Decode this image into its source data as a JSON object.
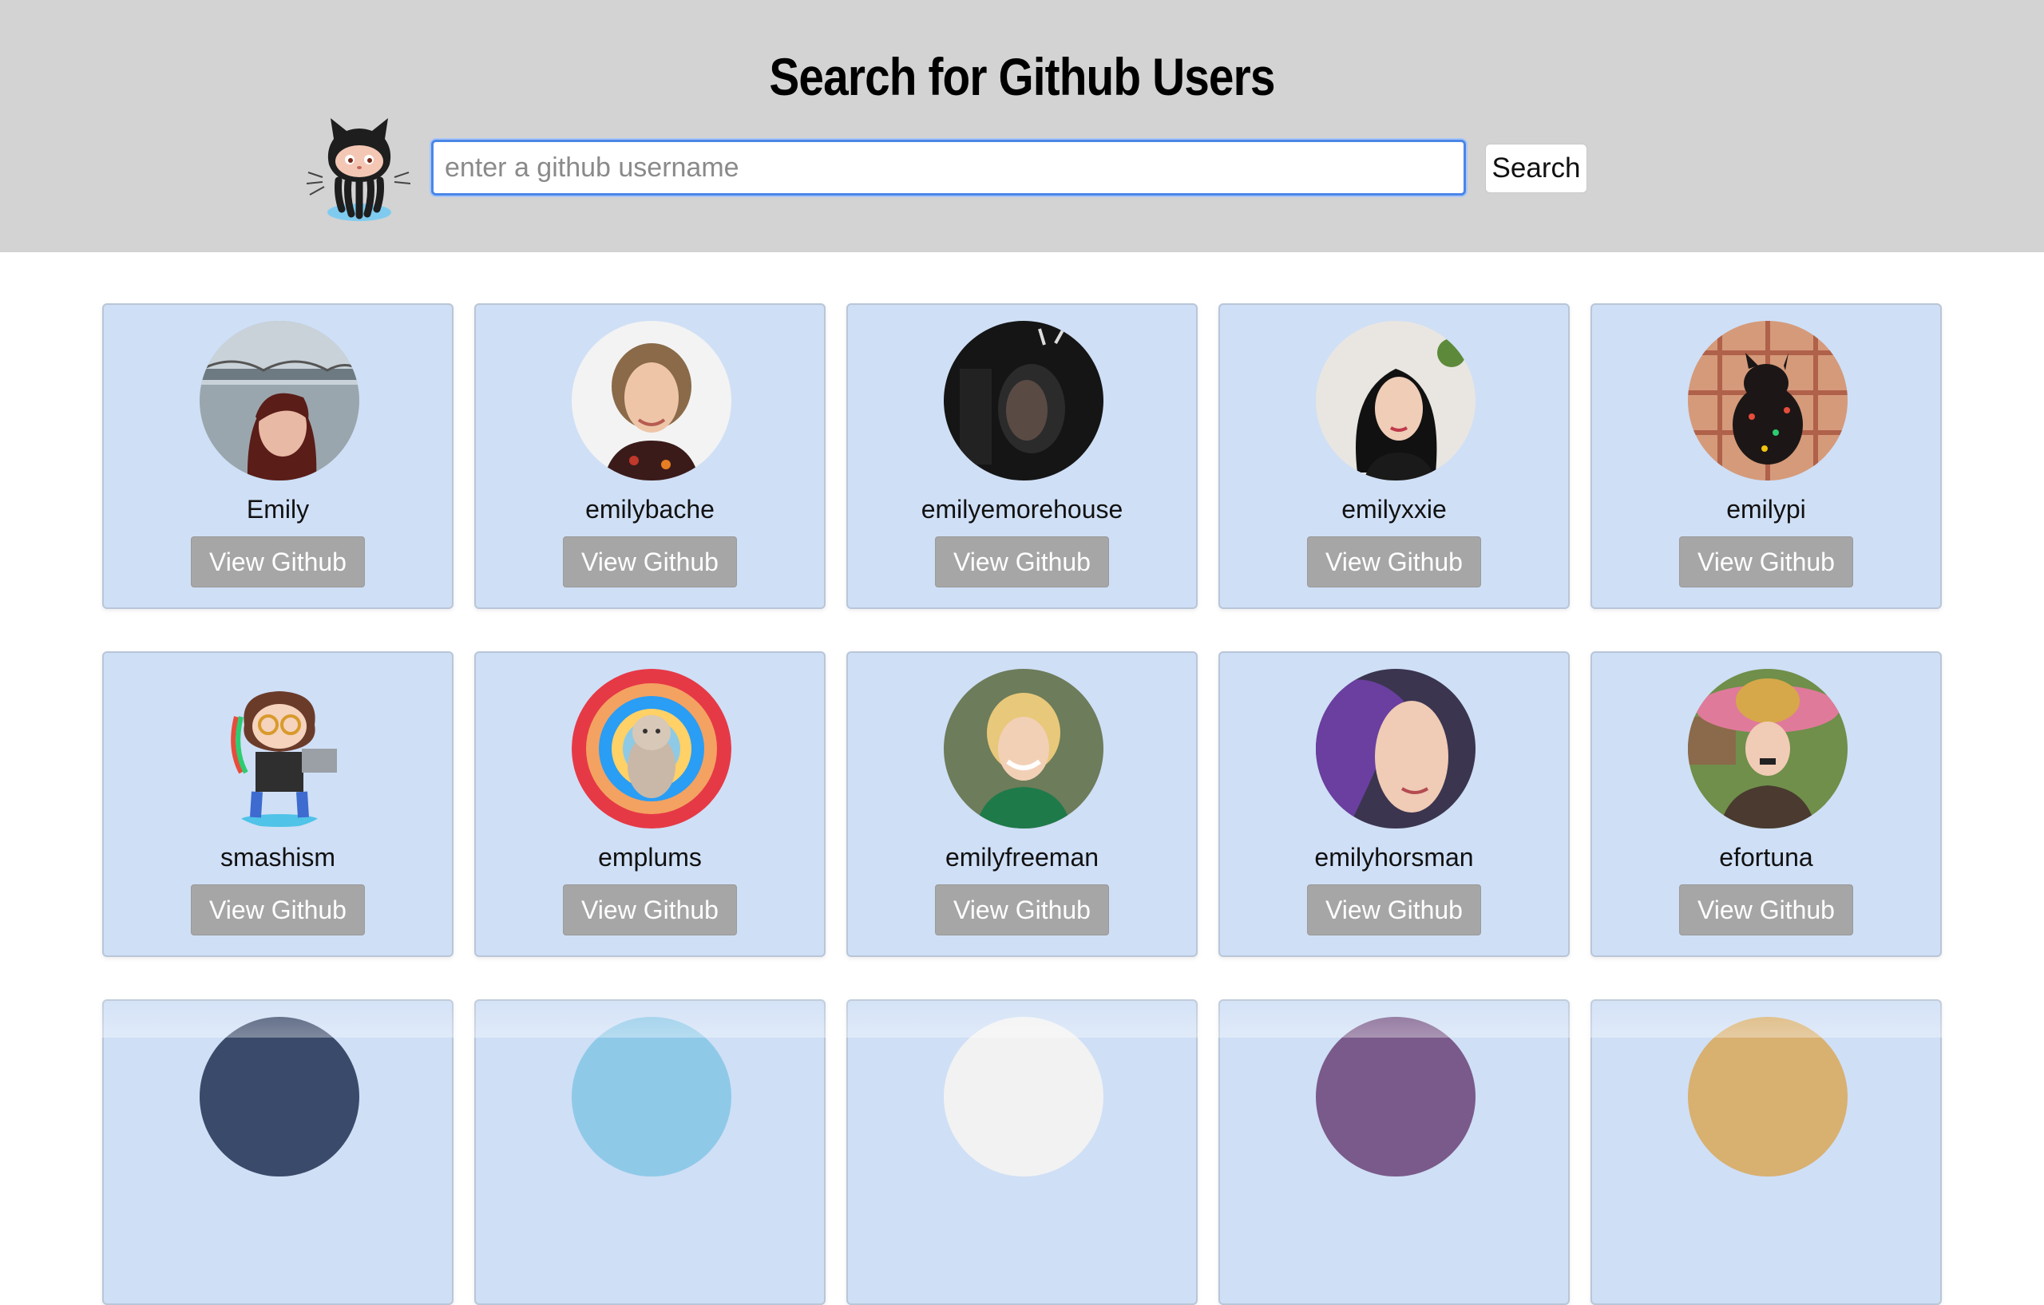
{
  "header": {
    "title": "Search for Github Users",
    "logo_icon": "octocat-icon",
    "background": "#d3d3d3"
  },
  "search": {
    "placeholder": "enter a github username",
    "value": "",
    "button_label": "Search"
  },
  "colors": {
    "card_background": "#cfdff6",
    "button_background": "#a6a6a6",
    "input_focus": "#4a86e8"
  },
  "users": [
    {
      "username": "Emily",
      "button_label": "View Github"
    },
    {
      "username": "emilybache",
      "button_label": "View Github"
    },
    {
      "username": "emilyemorehouse",
      "button_label": "View Github"
    },
    {
      "username": "emilyxxie",
      "button_label": "View Github"
    },
    {
      "username": "emilypi",
      "button_label": "View Github"
    },
    {
      "username": "smashism",
      "button_label": "View Github"
    },
    {
      "username": "emplums",
      "button_label": "View Github"
    },
    {
      "username": "emilyfreeman",
      "button_label": "View Github"
    },
    {
      "username": "emilyhorsman",
      "button_label": "View Github"
    },
    {
      "username": "efortuna",
      "button_label": "View Github"
    }
  ]
}
